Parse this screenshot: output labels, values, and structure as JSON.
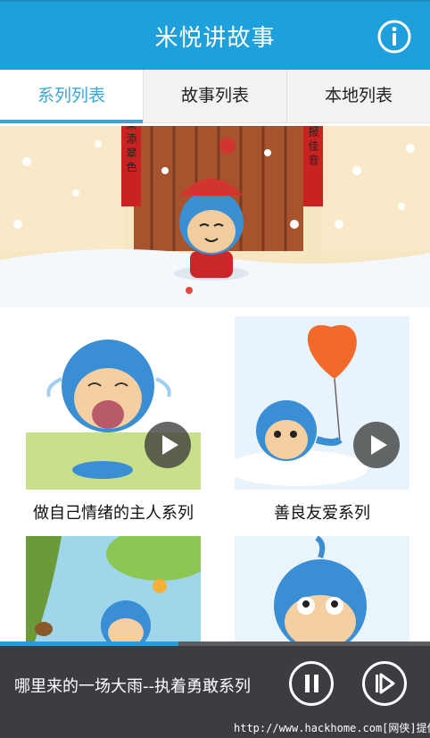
{
  "header": {
    "title": "米悦讲故事",
    "info_icon": "info-icon"
  },
  "tabs": [
    {
      "label": "系列列表",
      "active": true
    },
    {
      "label": "故事列表",
      "active": false
    },
    {
      "label": "本地列表",
      "active": false
    }
  ],
  "banner": {
    "couplet_left": "春 菜 添 翠 色",
    "couplet_right": "瑞 报 佳 音"
  },
  "series": [
    {
      "title": "做自己情绪的主人系列",
      "icon": "play-icon"
    },
    {
      "title": "善良友爱系列",
      "icon": "play-icon"
    },
    {
      "title": "",
      "icon": ""
    },
    {
      "title": "",
      "icon": ""
    }
  ],
  "player": {
    "now_playing": "哪里来的一场大雨--执着勇敢系列",
    "progress": 0.415,
    "pause_icon": "pause-icon",
    "next_icon": "next-icon"
  },
  "watermark": "http://www.hackhome.com[网侠]提供",
  "colors": {
    "accent": "#1ea0dc",
    "player_bg": "#3c3d42"
  }
}
